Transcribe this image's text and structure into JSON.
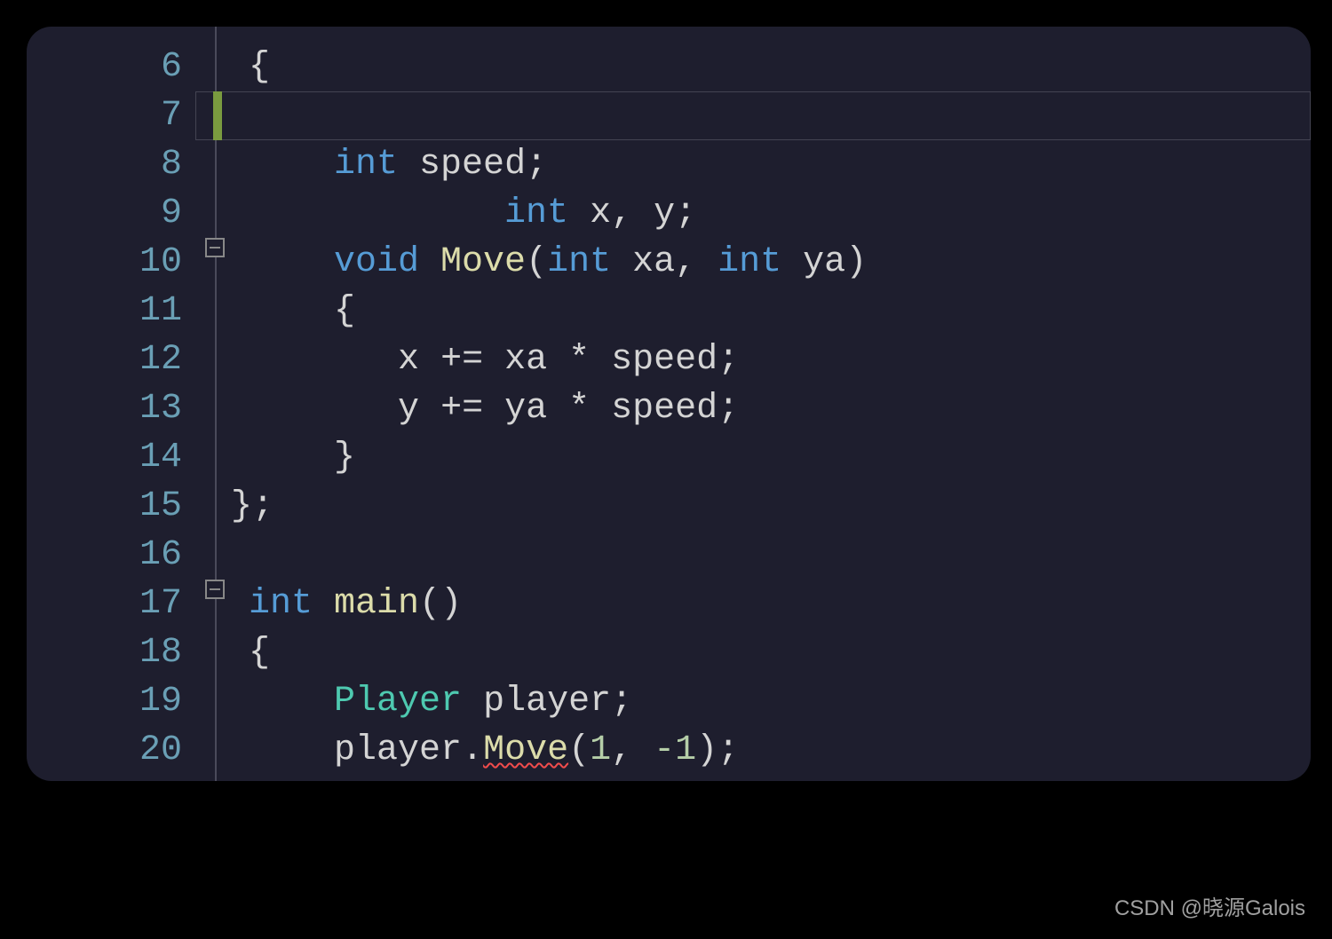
{
  "watermark": "CSDN @晓源Galois",
  "lines": {
    "l6": {
      "num": "6"
    },
    "l7": {
      "num": "7"
    },
    "l8": {
      "num": "8"
    },
    "l9": {
      "num": "9"
    },
    "l10": {
      "num": "10"
    },
    "l11": {
      "num": "11"
    },
    "l12": {
      "num": "12"
    },
    "l13": {
      "num": "13"
    },
    "l14": {
      "num": "14"
    },
    "l15": {
      "num": "15"
    },
    "l16": {
      "num": "16"
    },
    "l17": {
      "num": "17"
    },
    "l18": {
      "num": "18"
    },
    "l19": {
      "num": "19"
    },
    "l20": {
      "num": "20"
    }
  },
  "tok": {
    "int": "int",
    "void": "void",
    "Move": "Move",
    "Player": "Player",
    "main": "main",
    "x": "x",
    "y": "y",
    "xa": "xa",
    "ya": "ya",
    "speed": "speed",
    "player": "player",
    "obrace": "{",
    "cbrace": "}",
    "cbrace_semi": "};",
    "oparen": "(",
    "cparen": ")",
    "comma": ", ",
    "comma2": ",",
    "semi": ";",
    "pleq": "+=",
    "star": "*",
    "dot": ".",
    "one": "1",
    "mone": "-1",
    "sp1": " ",
    "sp2": "  ",
    "sp3": "   ",
    "sp4": "    "
  }
}
